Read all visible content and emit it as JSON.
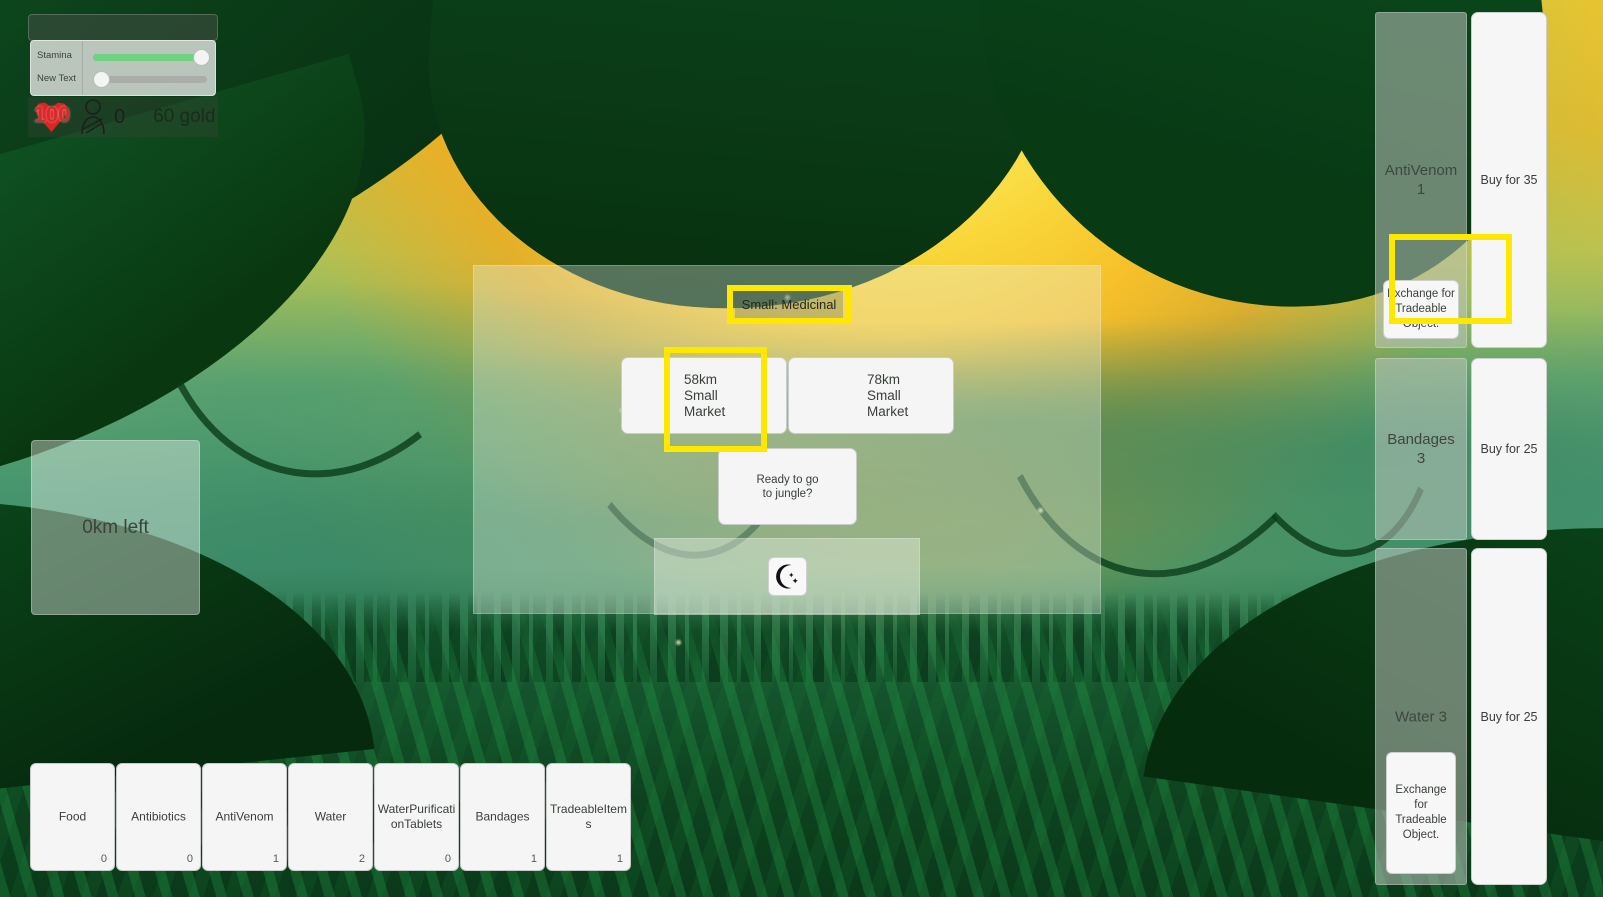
{
  "hud": {
    "sliders": [
      {
        "label": "Stamina",
        "value": 100
      },
      {
        "label": "New Text",
        "value": 0
      }
    ],
    "health": "100",
    "health_icon": "heart-icon",
    "injuries": "0",
    "injury_icon": "injured-person-icon",
    "gold": "60 gold"
  },
  "distance": {
    "text": "0km left"
  },
  "center": {
    "title": "Small: Medicinal",
    "markets": [
      {
        "line1": "58km",
        "line2": "Small",
        "line3": "Market"
      },
      {
        "line1": "78km",
        "line2": "Small",
        "line3": "Market"
      }
    ],
    "jungle_prompt_line1": "Ready to go",
    "jungle_prompt_line2": "to jungle?",
    "night_icon": "crescent-moon-icon"
  },
  "shop": {
    "exchange_label": "Exchange for Tradeable Object.",
    "items": [
      {
        "name": "AntiVenom",
        "qty": "1",
        "buy_label": "Buy for 35",
        "has_exchange": true
      },
      {
        "name": "Bandages",
        "qty": "3",
        "buy_label": "Buy for 25",
        "has_exchange": false
      },
      {
        "name": "Water",
        "qty": "3",
        "buy_label": "Buy for 25",
        "has_exchange": true
      }
    ]
  },
  "inventory": [
    {
      "name": "Food",
      "qty": "0"
    },
    {
      "name": "Antibiotics",
      "qty": "0"
    },
    {
      "name": "AntiVenom",
      "qty": "1"
    },
    {
      "name": "Water",
      "qty": "2"
    },
    {
      "name": "WaterPurificationTablets",
      "qty": "0"
    },
    {
      "name": "Bandages",
      "qty": "1"
    },
    {
      "name": "TradeableItems",
      "qty": "1"
    }
  ],
  "highlights": {
    "accent_color": "#ffe800",
    "targets": [
      "market-title",
      "market-button-58km",
      "shop-exchange-antivenom"
    ]
  }
}
